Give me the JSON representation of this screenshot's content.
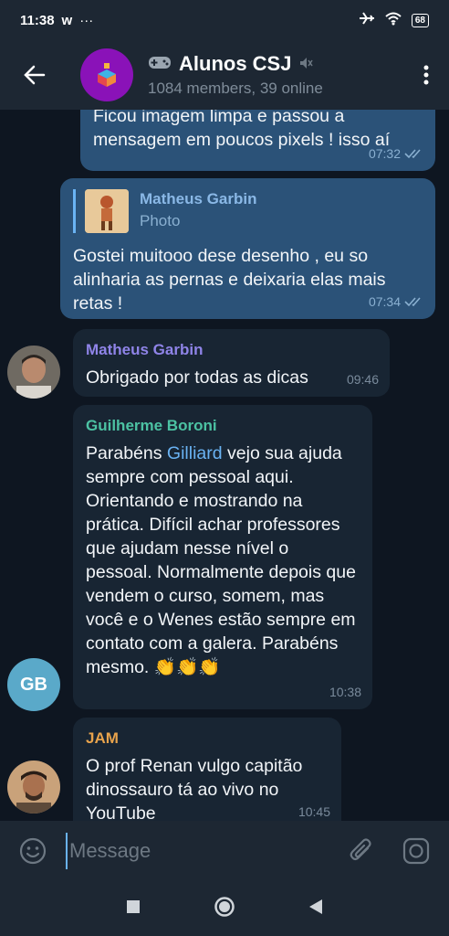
{
  "status_bar": {
    "time": "11:38",
    "app_mark": "w",
    "more": "···",
    "battery": "68"
  },
  "header": {
    "title": "Alunos CSJ",
    "subtitle": "1084 members, 39 online"
  },
  "messages": [
    {
      "text": "Ficou imagem limpa e passou a mensagem em poucos pixels ! isso aí",
      "time": "07:32"
    },
    {
      "reply_name": "Matheus Garbin",
      "reply_type": "Photo",
      "text": "Gostei muitooo dese desenho , eu so alinharia as pernas e deixaria elas mais retas !",
      "time": "07:34"
    },
    {
      "sender": "Matheus Garbin",
      "text": "Obrigado por todas as dicas",
      "time": "09:46"
    },
    {
      "sender": "Guilherme Boroni",
      "text_before": "Parabéns ",
      "mention": "Gilliard",
      "text_after": " vejo sua ajuda sempre com pessoal aqui. Orientando e mostrando na prática. Difícil achar professores que ajudam nesse nível o pessoal. Normalmente depois que vendem o curso, somem, mas você e o Wenes estão sempre em contato com a galera. Parabéns mesmo. 👏👏👏",
      "time": "10:38",
      "avatar_initials": "GB"
    },
    {
      "sender": "JAM",
      "text": "O prof Renan vulgo capitão dinossauro tá ao vivo no YouTube",
      "time": "10:45"
    }
  ],
  "input": {
    "placeholder": "Message"
  },
  "colors": {
    "accent": "#6ab3f3",
    "header_bg": "#1d2733",
    "chat_bg": "#0e1621",
    "out_bubble": "#2b5278",
    "in_bubble": "#182533",
    "group_avatar": "#8a12b8",
    "gb_avatar": "#5aa9c9"
  }
}
